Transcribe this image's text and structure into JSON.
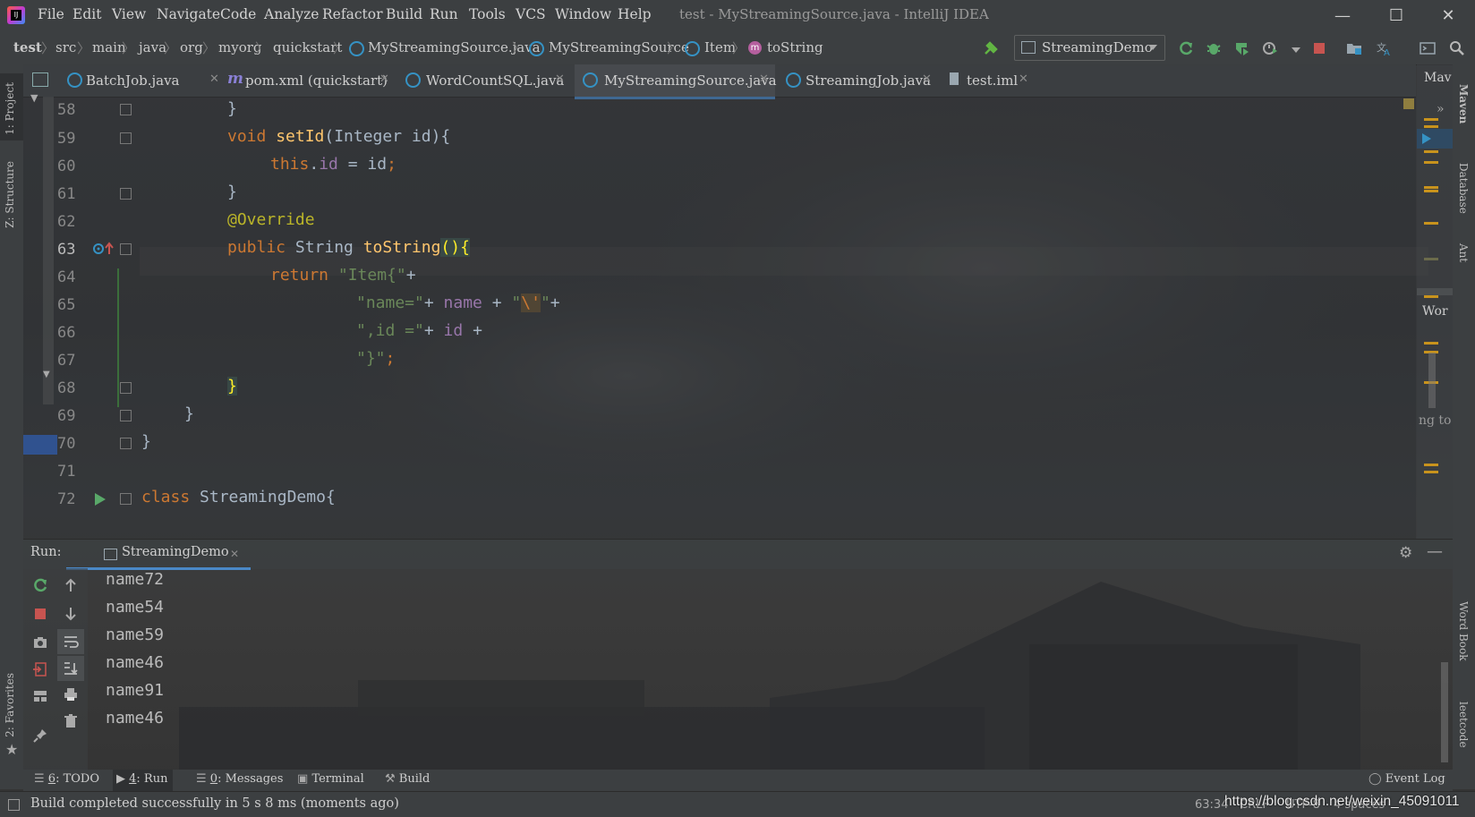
{
  "window": {
    "title": "test - MyStreamingSource.java - IntelliJ IDEA",
    "menu": [
      "File",
      "Edit",
      "View",
      "Navigate",
      "Code",
      "Analyze",
      "Refactor",
      "Build",
      "Run",
      "Tools",
      "VCS",
      "Window",
      "Help"
    ]
  },
  "breadcrumbs": [
    "test",
    "src",
    "main",
    "java",
    "org",
    "myorg",
    "quickstart",
    "MyStreamingSource.java",
    "MyStreamingSource",
    "Item",
    "toString"
  ],
  "run_config": "StreamingDemo",
  "left_strip": {
    "project": "1: Project",
    "structure": "Z: Structure",
    "favorites": "2: Favorites"
  },
  "right_strip": {
    "maven": "Maven",
    "database": "Database",
    "ant": "Ant",
    "wordbook": "Word Book",
    "leetcode": "leetcode"
  },
  "right_panel": {
    "mav": "Mav",
    "wor": "Wor",
    "dots": "..",
    "ng_to": "ng to"
  },
  "tabs": [
    {
      "label": "BatchJob.java",
      "icon": "class-icon"
    },
    {
      "label": "pom.xml (quickstart)",
      "icon": "maven-icon"
    },
    {
      "label": "WordCountSQL.java",
      "icon": "class-icon"
    },
    {
      "label": "MyStreamingSource.java",
      "icon": "class-icon",
      "active": true
    },
    {
      "label": "StreamingJob.java",
      "icon": "class-icon"
    },
    {
      "label": "test.iml",
      "icon": "file-icon"
    }
  ],
  "editor": {
    "line_numbers": [
      "58",
      "59",
      "60",
      "61",
      "62",
      "63",
      "64",
      "65",
      "66",
      "67",
      "68",
      "69",
      "70",
      "71",
      "72"
    ],
    "caret_line": "63"
  },
  "run": {
    "label": "Run:",
    "tab": "StreamingDemo",
    "output": [
      "name72",
      "name54",
      "name59",
      "name46",
      "name91",
      "name46"
    ]
  },
  "tool_windows": [
    {
      "key": "6",
      "label": ": TODO"
    },
    {
      "key": "4",
      "label": ": Run"
    },
    {
      "key": "0",
      "label": ": Messages"
    },
    {
      "key": "",
      "label": "Terminal"
    },
    {
      "key": "",
      "label": "Build"
    }
  ],
  "event_log": "Event Log",
  "status": {
    "message": "Build completed successfully in 5 s 8 ms (moments ago)",
    "position": "63:34",
    "line_sep": "CRLF",
    "encoding": "UTF-8",
    "indent": "4 spaces",
    "watermark": "https://blog.csdn.net/weixin_45091011"
  }
}
